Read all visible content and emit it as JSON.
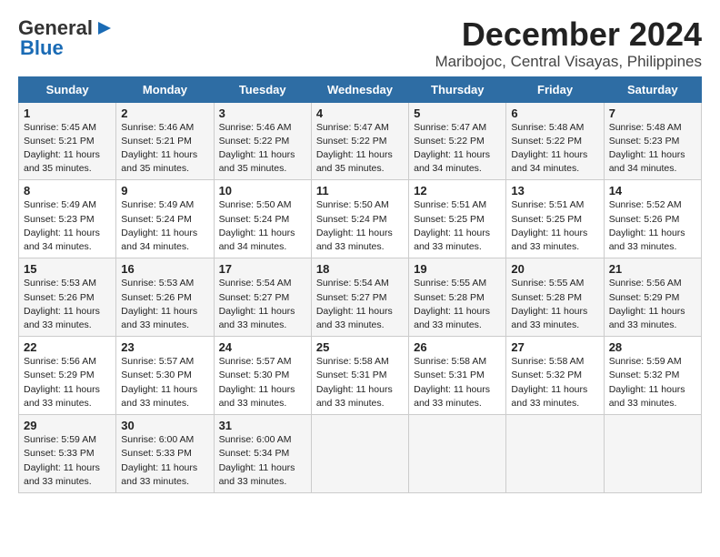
{
  "logo": {
    "line1": "General",
    "line2": "Blue"
  },
  "title": "December 2024",
  "subtitle": "Maribojoc, Central Visayas, Philippines",
  "days_of_week": [
    "Sunday",
    "Monday",
    "Tuesday",
    "Wednesday",
    "Thursday",
    "Friday",
    "Saturday"
  ],
  "weeks": [
    [
      {
        "day": "1",
        "sunrise": "5:45 AM",
        "sunset": "5:21 PM",
        "daylight": "11 hours and 35 minutes."
      },
      {
        "day": "2",
        "sunrise": "5:46 AM",
        "sunset": "5:21 PM",
        "daylight": "11 hours and 35 minutes."
      },
      {
        "day": "3",
        "sunrise": "5:46 AM",
        "sunset": "5:22 PM",
        "daylight": "11 hours and 35 minutes."
      },
      {
        "day": "4",
        "sunrise": "5:47 AM",
        "sunset": "5:22 PM",
        "daylight": "11 hours and 35 minutes."
      },
      {
        "day": "5",
        "sunrise": "5:47 AM",
        "sunset": "5:22 PM",
        "daylight": "11 hours and 34 minutes."
      },
      {
        "day": "6",
        "sunrise": "5:48 AM",
        "sunset": "5:22 PM",
        "daylight": "11 hours and 34 minutes."
      },
      {
        "day": "7",
        "sunrise": "5:48 AM",
        "sunset": "5:23 PM",
        "daylight": "11 hours and 34 minutes."
      }
    ],
    [
      {
        "day": "8",
        "sunrise": "5:49 AM",
        "sunset": "5:23 PM",
        "daylight": "11 hours and 34 minutes."
      },
      {
        "day": "9",
        "sunrise": "5:49 AM",
        "sunset": "5:24 PM",
        "daylight": "11 hours and 34 minutes."
      },
      {
        "day": "10",
        "sunrise": "5:50 AM",
        "sunset": "5:24 PM",
        "daylight": "11 hours and 34 minutes."
      },
      {
        "day": "11",
        "sunrise": "5:50 AM",
        "sunset": "5:24 PM",
        "daylight": "11 hours and 33 minutes."
      },
      {
        "day": "12",
        "sunrise": "5:51 AM",
        "sunset": "5:25 PM",
        "daylight": "11 hours and 33 minutes."
      },
      {
        "day": "13",
        "sunrise": "5:51 AM",
        "sunset": "5:25 PM",
        "daylight": "11 hours and 33 minutes."
      },
      {
        "day": "14",
        "sunrise": "5:52 AM",
        "sunset": "5:26 PM",
        "daylight": "11 hours and 33 minutes."
      }
    ],
    [
      {
        "day": "15",
        "sunrise": "5:53 AM",
        "sunset": "5:26 PM",
        "daylight": "11 hours and 33 minutes."
      },
      {
        "day": "16",
        "sunrise": "5:53 AM",
        "sunset": "5:26 PM",
        "daylight": "11 hours and 33 minutes."
      },
      {
        "day": "17",
        "sunrise": "5:54 AM",
        "sunset": "5:27 PM",
        "daylight": "11 hours and 33 minutes."
      },
      {
        "day": "18",
        "sunrise": "5:54 AM",
        "sunset": "5:27 PM",
        "daylight": "11 hours and 33 minutes."
      },
      {
        "day": "19",
        "sunrise": "5:55 AM",
        "sunset": "5:28 PM",
        "daylight": "11 hours and 33 minutes."
      },
      {
        "day": "20",
        "sunrise": "5:55 AM",
        "sunset": "5:28 PM",
        "daylight": "11 hours and 33 minutes."
      },
      {
        "day": "21",
        "sunrise": "5:56 AM",
        "sunset": "5:29 PM",
        "daylight": "11 hours and 33 minutes."
      }
    ],
    [
      {
        "day": "22",
        "sunrise": "5:56 AM",
        "sunset": "5:29 PM",
        "daylight": "11 hours and 33 minutes."
      },
      {
        "day": "23",
        "sunrise": "5:57 AM",
        "sunset": "5:30 PM",
        "daylight": "11 hours and 33 minutes."
      },
      {
        "day": "24",
        "sunrise": "5:57 AM",
        "sunset": "5:30 PM",
        "daylight": "11 hours and 33 minutes."
      },
      {
        "day": "25",
        "sunrise": "5:58 AM",
        "sunset": "5:31 PM",
        "daylight": "11 hours and 33 minutes."
      },
      {
        "day": "26",
        "sunrise": "5:58 AM",
        "sunset": "5:31 PM",
        "daylight": "11 hours and 33 minutes."
      },
      {
        "day": "27",
        "sunrise": "5:58 AM",
        "sunset": "5:32 PM",
        "daylight": "11 hours and 33 minutes."
      },
      {
        "day": "28",
        "sunrise": "5:59 AM",
        "sunset": "5:32 PM",
        "daylight": "11 hours and 33 minutes."
      }
    ],
    [
      {
        "day": "29",
        "sunrise": "5:59 AM",
        "sunset": "5:33 PM",
        "daylight": "11 hours and 33 minutes."
      },
      {
        "day": "30",
        "sunrise": "6:00 AM",
        "sunset": "5:33 PM",
        "daylight": "11 hours and 33 minutes."
      },
      {
        "day": "31",
        "sunrise": "6:00 AM",
        "sunset": "5:34 PM",
        "daylight": "11 hours and 33 minutes."
      },
      null,
      null,
      null,
      null
    ]
  ]
}
